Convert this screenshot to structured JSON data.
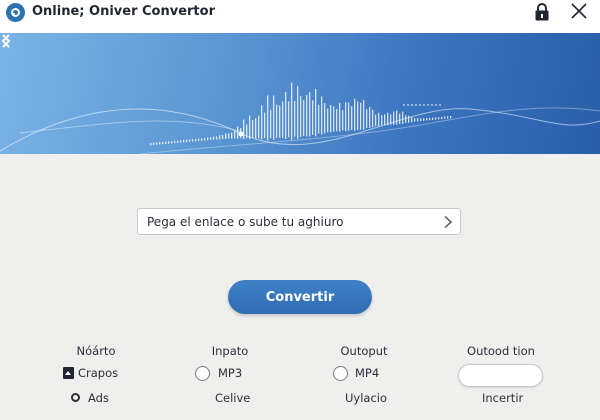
{
  "window": {
    "title": "Online; Oniver Convertor",
    "brand_color": "#2d73b3"
  },
  "banner": {
    "gradient": [
      "#7ab3e7",
      "#2a5ea9"
    ]
  },
  "input": {
    "placeholder": "Pega el enlace o sube tu aghiuro",
    "value": ""
  },
  "actions": {
    "convert_label": "Convertir",
    "convert_color": "#2f6db4"
  },
  "options": {
    "format": {
      "header": "Nóárto",
      "items": [
        {
          "label": "Crapos",
          "selected": true
        },
        {
          "label": "Ads",
          "selected": false
        }
      ]
    },
    "input": {
      "header": "Inpato",
      "items": [
        {
          "label": "MP3",
          "selected": false
        },
        {
          "label": "Celive"
        }
      ]
    },
    "output": {
      "header": "Outoput",
      "items": [
        {
          "label": "MP4",
          "selected": false
        },
        {
          "label": "Uylacio"
        }
      ]
    },
    "destination": {
      "header": "Outood tion",
      "field_value": "",
      "footer": "Incertir"
    }
  },
  "icons": {
    "logo": "app-logo-icon",
    "lock": "lock-icon",
    "close": "close-icon",
    "prev": "chevron-left-icon",
    "next": "chevron-right-icon",
    "go": "chevron-right-icon"
  }
}
